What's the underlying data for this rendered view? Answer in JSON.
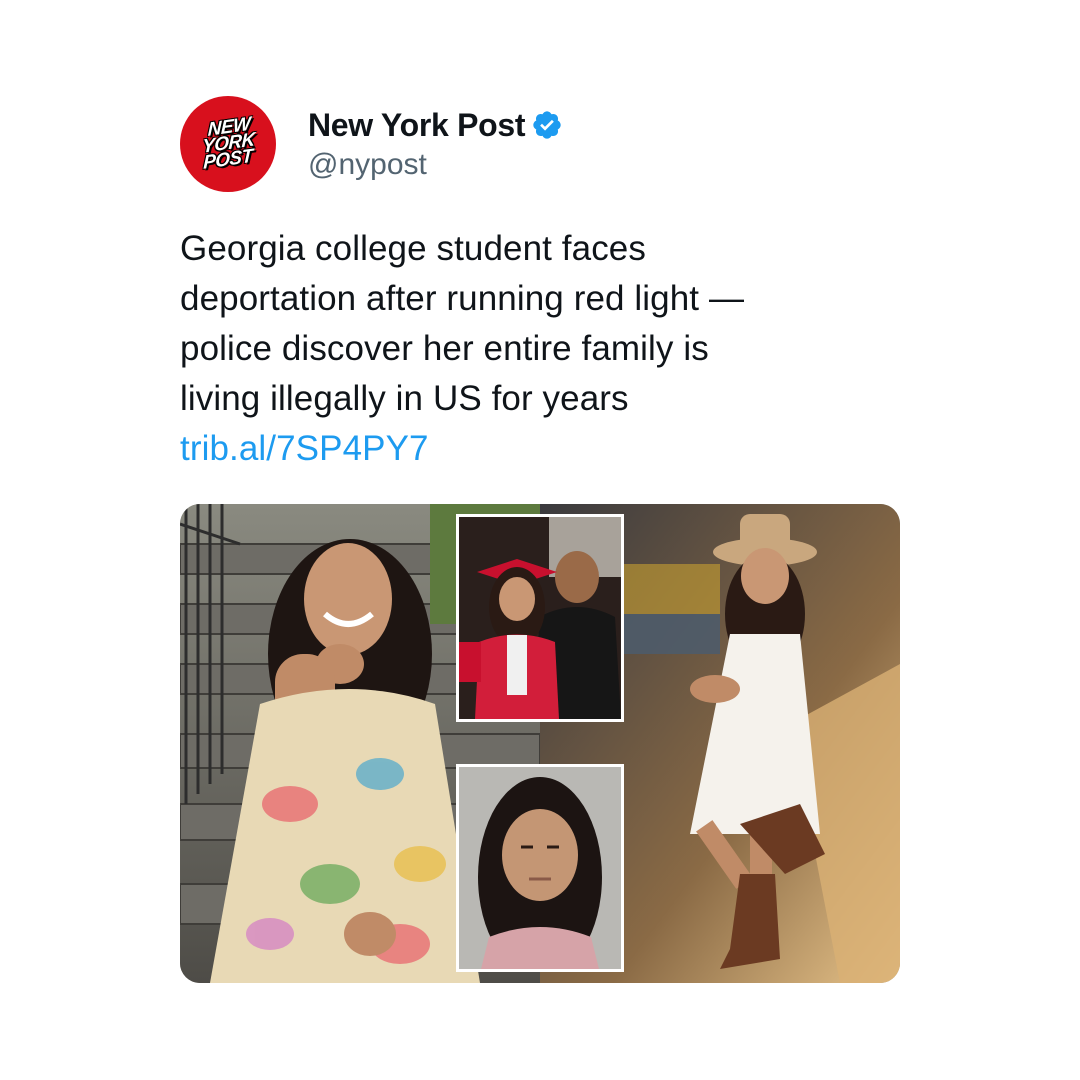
{
  "account": {
    "display_name": "New York Post",
    "handle": "@nypost",
    "avatar_logo_lines": [
      "NEW",
      "YORK",
      "POST"
    ],
    "verified_icon": "verified-badge-icon"
  },
  "tweet": {
    "text_lines": [
      "Georgia college student faces",
      "deportation after running red light —",
      "police discover her entire family is",
      "living illegally in US for years"
    ],
    "link": "trib.al/7SP4PY7"
  },
  "colors": {
    "brand_red": "#d8101d",
    "link_blue": "#1d9bf0",
    "verified_blue": "#1d9bf0",
    "handle_gray": "#536471"
  }
}
